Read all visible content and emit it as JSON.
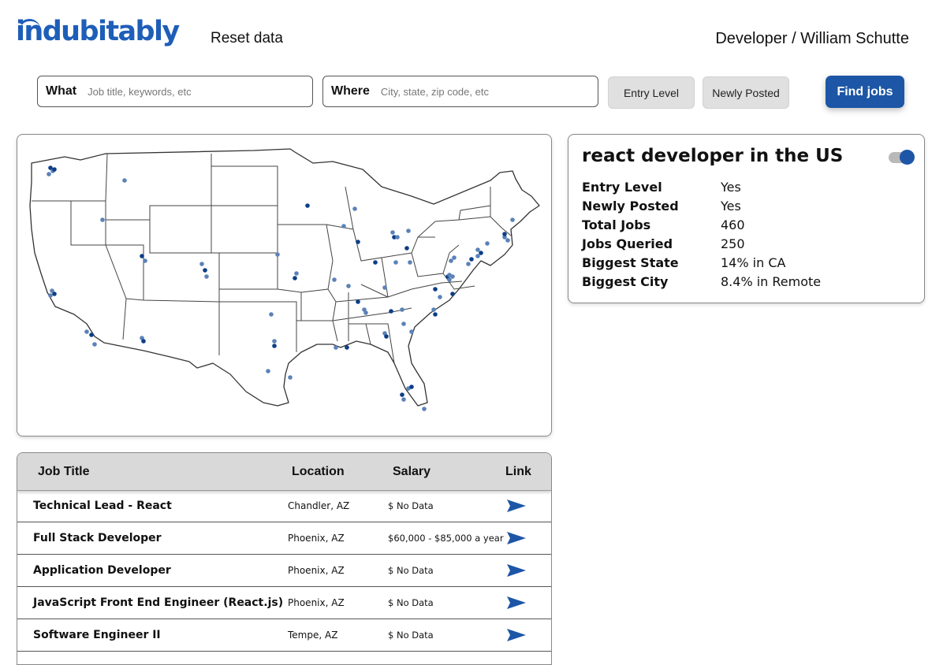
{
  "header": {
    "logo_text": "indubitably",
    "reset_label": "Reset data",
    "breadcrumb": "Developer / William Schutte"
  },
  "search": {
    "what_label": "What",
    "what_placeholder": "Job title, keywords, etc",
    "where_label": "Where",
    "where_placeholder": "City, state, zip code, etc",
    "entry_level_label": "Entry Level",
    "newly_posted_label": "Newly Posted",
    "find_label": "Find jobs"
  },
  "summary": {
    "title": "react developer in the US",
    "toggle_on": true,
    "rows": [
      {
        "key": "Entry Level",
        "value": "Yes"
      },
      {
        "key": "Newly Posted",
        "value": "Yes"
      },
      {
        "key": "Total Jobs",
        "value": "460"
      },
      {
        "key": "Jobs Queried",
        "value": "250"
      },
      {
        "key": "Biggest State",
        "value": "14% in CA"
      },
      {
        "key": "Biggest City",
        "value": "8.4% in Remote"
      }
    ]
  },
  "table": {
    "headers": {
      "title": "Job Title",
      "location": "Location",
      "salary": "Salary",
      "link": "Link"
    },
    "rows": [
      {
        "title": "Technical Lead - React",
        "location": "Chandler, AZ",
        "salary": "$ No Data"
      },
      {
        "title": "Full Stack Developer",
        "location": "Phoenix, AZ",
        "salary": "$60,000 - $85,000 a year"
      },
      {
        "title": "Application Developer",
        "location": "Phoenix, AZ",
        "salary": "$ No Data"
      },
      {
        "title": "JavaScript Front End Engineer (React.js)",
        "location": "Phoenix, AZ",
        "salary": "$ No Data"
      },
      {
        "title": "Software Engineer II",
        "location": "Tempe, AZ",
        "salary": "$ No Data"
      }
    ]
  },
  "colors": {
    "brand": "#1e5eb8",
    "button": "#1d56a6",
    "dot_dark": "#0d3d86",
    "dot_light": "#5b82b8"
  },
  "icons": {
    "link": "send-arrow-icon"
  }
}
